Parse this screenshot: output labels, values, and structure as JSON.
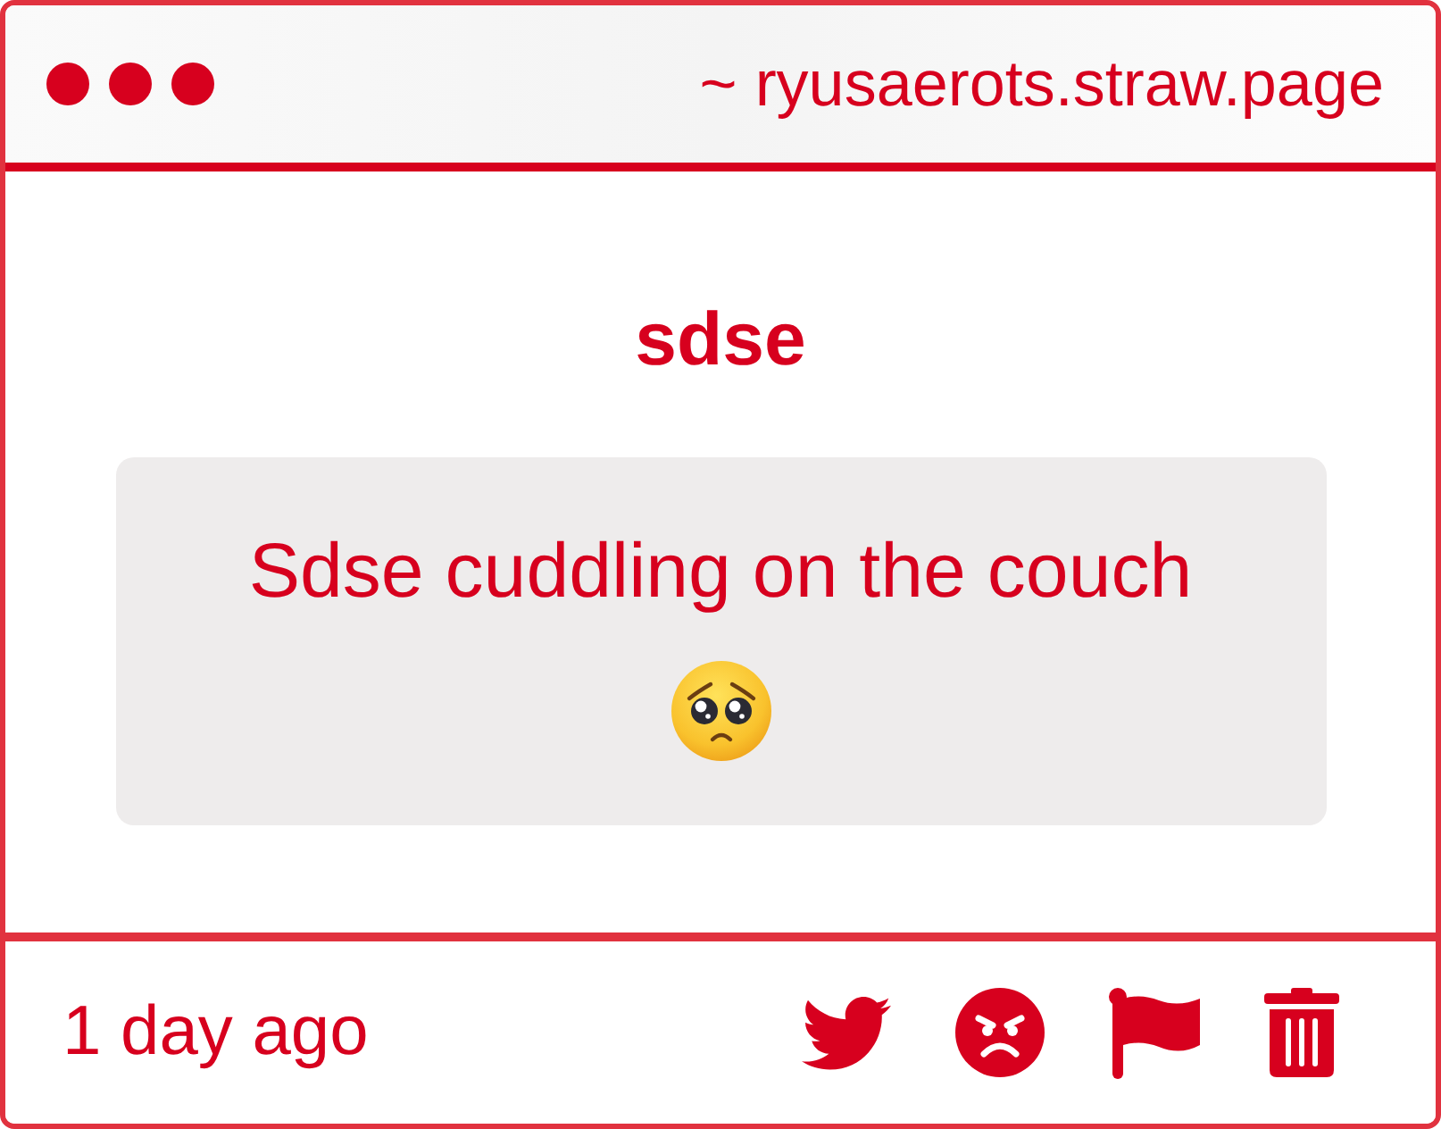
{
  "window": {
    "url": "~ ryusaerots.straw.page"
  },
  "post": {
    "title": "sdse",
    "body": "Sdse cuddling on the couch"
  },
  "footer": {
    "time": "1 day ago",
    "actions": [
      {
        "kind": "share"
      },
      {
        "kind": "react"
      },
      {
        "kind": "report"
      },
      {
        "kind": "delete"
      }
    ]
  }
}
